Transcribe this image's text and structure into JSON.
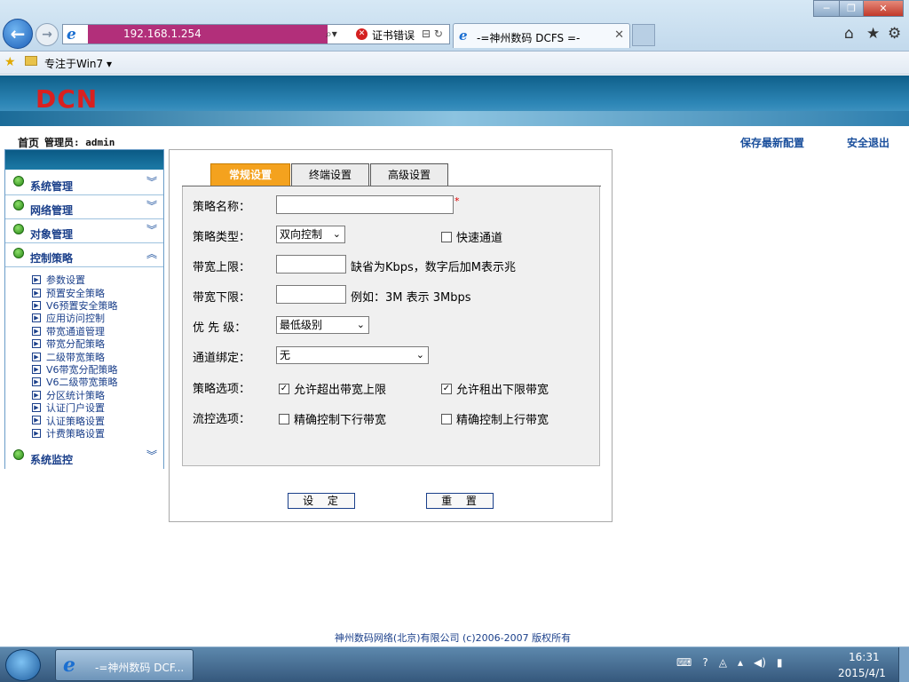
{
  "browser": {
    "address": "192.168.1.254",
    "cert_error": "证书错误",
    "tab_title": "-=神州数码 DCFS =-",
    "favorites_label": "专注于Win7 ▾"
  },
  "header": {
    "logo": "DCN",
    "home": "首页",
    "admin_label": "管理员: admin",
    "save_config": "保存最新配置",
    "logout": "安全退出"
  },
  "sidebar": {
    "sections": [
      {
        "label": "系统管理",
        "state": "collapsed"
      },
      {
        "label": "网络管理",
        "state": "collapsed"
      },
      {
        "label": "对象管理",
        "state": "collapsed"
      },
      {
        "label": "控制策略",
        "state": "expanded"
      },
      {
        "label": "系统监控",
        "state": "collapsed"
      }
    ],
    "sub_items": [
      "参数设置",
      "预置安全策略",
      "V6预置安全策略",
      "应用访问控制",
      "带宽通道管理",
      "带宽分配策略",
      "二级带宽策略",
      "V6带宽分配策略",
      "V6二级带宽策略",
      "分区统计策略",
      "认证门户设置",
      "认证策略设置",
      "计费策略设置"
    ]
  },
  "tabs": [
    "常规设置",
    "终端设置",
    "高级设置"
  ],
  "form": {
    "name_label": "策略名称：",
    "name_value": "",
    "required_mark": "*",
    "type_label": "策略类型：",
    "type_value": "双向控制",
    "fast_channel": "快速通道",
    "upper_label": "带宽上限：",
    "upper_hint": "缺省为Kbps，数字后加M表示兆",
    "lower_label": "带宽下限：",
    "lower_hint": "例如：3M 表示 3Mbps",
    "priority_label": "优 先 级：",
    "priority_value": "最低级别",
    "channel_label": "通道绑定：",
    "channel_value": "无",
    "options_label": "策略选项：",
    "opt_exceed": "允许超出带宽上限",
    "opt_lend": "允许租出下限带宽",
    "flow_label": "流控选项：",
    "flow_down": "精确控制下行带宽",
    "flow_up": "精确控制上行带宽"
  },
  "buttons": {
    "set": "设 定",
    "reset": "重 置"
  },
  "footer": "神州数码网络(北京)有限公司 (c)2006-2007 版权所有",
  "taskbar": {
    "app": "-=神州数码 DCF...",
    "time": "16:31",
    "date": "2015/4/1"
  }
}
